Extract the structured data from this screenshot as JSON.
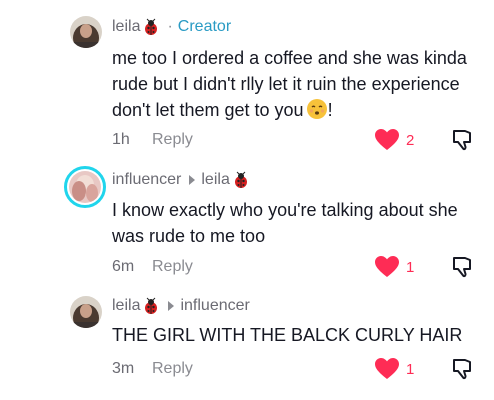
{
  "comments": [
    {
      "username": "leila",
      "badge": "Creator",
      "reply_to": "",
      "text": "me too I ordered a coffee and she was kinda rude but I didn't rlly let it ruin the experience don't let them get to you",
      "text_suffix": "!",
      "time": "1h",
      "reply_label": "Reply",
      "likes": "2",
      "liked": true
    },
    {
      "username": "influencer",
      "badge": "",
      "reply_to": "leila",
      "text": "I know exactly who you're talking about she was rude to me too",
      "time": "6m",
      "reply_label": "Reply",
      "likes": "1",
      "liked": true
    },
    {
      "username": "leila",
      "badge": "",
      "reply_to": "influencer",
      "text": "THE GIRL WITH THE BALCK CURLY HAIR",
      "time": "3m",
      "reply_label": "Reply",
      "likes": "1",
      "liked": true
    }
  ],
  "colors": {
    "like": "#fe2c55",
    "creator": "#2a9bc4",
    "ring": "#20d5ec",
    "text": "#161823",
    "muted": "#8a8b91"
  },
  "icons": [
    "ladybug-icon",
    "smiling-emoji-icon",
    "heart-icon",
    "dislike-icon",
    "reply-arrow-icon"
  ]
}
